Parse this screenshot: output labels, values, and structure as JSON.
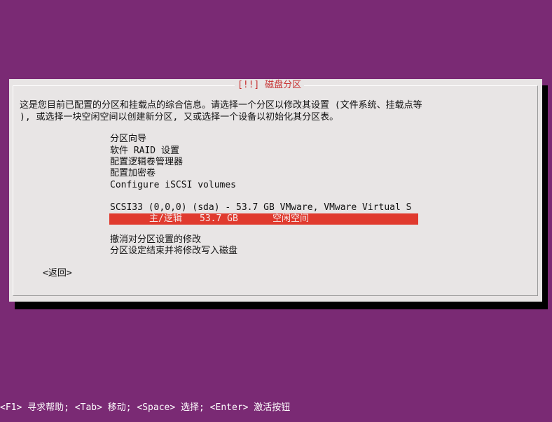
{
  "dialog": {
    "title": "[!!] 磁盘分区",
    "description_line1": "这是您目前已配置的分区和挂载点的综合信息。请选择一个分区以修改其设置 (文件系统、挂载点等",
    "description_line2": "), 或选择一块空闲空间以创建新分区, 又或选择一个设备以初始化其分区表。",
    "menu": {
      "guided": "分区向导",
      "raid": "软件 RAID 设置",
      "lvm": "配置逻辑卷管理器",
      "crypto": "配置加密卷",
      "iscsi": "Configure iSCSI volumes"
    },
    "disk": {
      "label": "SCSI33 (0,0,0) (sda) - 53.7 GB VMware, VMware Virtual S"
    },
    "partition": {
      "type": "主/逻辑",
      "size": "53.7 GB",
      "status": "空闲空间"
    },
    "actions": {
      "undo": "撤消对分区设置的修改",
      "finish": "分区设定结束并将修改写入磁盘"
    },
    "back_label": "<返回>"
  },
  "footer": {
    "help": "<F1> 寻求帮助; <Tab> 移动; <Space> 选择; <Enter> 激活按钮"
  }
}
